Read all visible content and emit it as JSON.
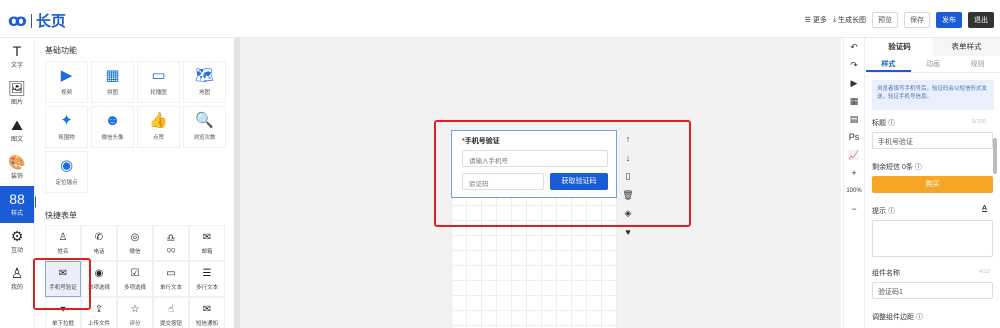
{
  "header": {
    "logo_mark": "ꝏ",
    "logo_text": "长页",
    "more_label": "更多",
    "longimg_label": "生成长图",
    "preview_label": "预览",
    "save_label": "保存",
    "publish_label": "发布",
    "exit_label": "退出"
  },
  "rail": {
    "items": [
      {
        "icon": "T",
        "label": "文字"
      },
      {
        "icon": "🖼",
        "label": "图片"
      },
      {
        "icon": "⛰",
        "label": "图文"
      },
      {
        "icon": "🎨",
        "label": "装饰"
      },
      {
        "icon": "88",
        "label": "样式"
      },
      {
        "icon": "⚙",
        "label": "互动"
      },
      {
        "icon": "♙",
        "label": "我的"
      }
    ]
  },
  "palette": {
    "basic_title": "基础功能",
    "basic_items": [
      {
        "icon": "▶",
        "label": "视频"
      },
      {
        "icon": "▦",
        "label": "拼图"
      },
      {
        "icon": "▭",
        "label": "轮播图"
      },
      {
        "icon": "🗺",
        "label": "地图"
      },
      {
        "icon": "✦",
        "label": "氛围物"
      },
      {
        "icon": "☻",
        "label": "微信头像"
      },
      {
        "icon": "👍",
        "label": "点赞"
      },
      {
        "icon": "🔍",
        "label": "浏览次数"
      },
      {
        "icon": "◉",
        "label": "定位锚点"
      }
    ],
    "form_title": "快捷表单",
    "form_items": [
      {
        "icon": "♙",
        "label": "姓名"
      },
      {
        "icon": "✆",
        "label": "电话"
      },
      {
        "icon": "◎",
        "label": "微信"
      },
      {
        "icon": "♎",
        "label": "QQ"
      },
      {
        "icon": "✉",
        "label": "邮箱"
      },
      {
        "icon": "✉",
        "label": "手机号验证"
      },
      {
        "icon": "◉",
        "label": "单项选择"
      },
      {
        "icon": "☑",
        "label": "多项选择"
      },
      {
        "icon": "▭",
        "label": "单行文本"
      },
      {
        "icon": "☰",
        "label": "多行文本"
      },
      {
        "icon": "▾",
        "label": "单下拉框"
      },
      {
        "icon": "⇪",
        "label": "上传文件"
      },
      {
        "icon": "☆",
        "label": "评分"
      },
      {
        "icon": "☝",
        "label": "提交按钮"
      },
      {
        "icon": "✉",
        "label": "短信通知"
      }
    ]
  },
  "canvas": {
    "form_title": "手机号验证",
    "phone_placeholder": "请输入手机号",
    "code_placeholder": "验证码",
    "get_code_label": "获取验证码",
    "tools": [
      "↑",
      "↓",
      "▯",
      "🗑",
      "◈",
      "♥"
    ]
  },
  "right_tools": {
    "items": [
      "↶",
      "↷",
      "▶",
      "▦",
      "▤",
      "Ps",
      "📈",
      "+"
    ],
    "zoom": "100%",
    "minus": "−"
  },
  "props": {
    "tab_verify": "验证码",
    "tab_form_style": "表单样式",
    "sub_style": "样式",
    "sub_anim": "动画",
    "sub_rules": "规则",
    "notice": "浏览者填写手机号后，验证码会以短信形式发送，验证手机号信息。",
    "title_label": "标题 ⓘ",
    "title_count": "5/100",
    "title_value": "手机号验证",
    "sms_label": "剩余短信 0条 ⓘ",
    "buy_label": "购买",
    "hint_label": "提示 ⓘ",
    "hint_icon": "A",
    "comp_name_label": "组件名称",
    "comp_name_count": "4/12",
    "comp_name_value": "验证码1",
    "margin_label": "调整组件边距 ⓘ"
  }
}
